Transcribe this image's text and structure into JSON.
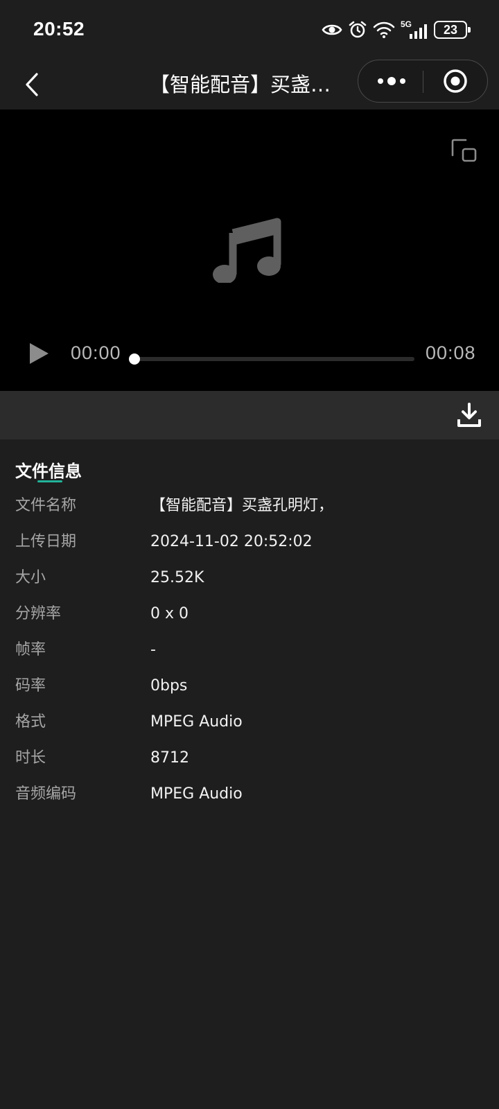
{
  "status_bar": {
    "time": "20:52",
    "network_label": "5G",
    "battery_level": "23"
  },
  "nav": {
    "title": "【智能配音】买盏…"
  },
  "player": {
    "current_time": "00:00",
    "total_time": "00:08",
    "progress_fraction": 0.0
  },
  "file_info": {
    "section_title": "文件信息",
    "rows": [
      {
        "label": "文件名称",
        "value": "【智能配音】买盏孔明灯，"
      },
      {
        "label": "上传日期",
        "value": "2024-11-02 20:52:02"
      },
      {
        "label": "大小",
        "value": "25.52K"
      },
      {
        "label": "分辨率",
        "value": "0 x 0"
      },
      {
        "label": "帧率",
        "value": "-"
      },
      {
        "label": "码率",
        "value": "0bps"
      },
      {
        "label": "格式",
        "value": "MPEG Audio"
      },
      {
        "label": "时长",
        "value": "8712"
      },
      {
        "label": "音频编码",
        "value": "MPEG Audio"
      }
    ]
  },
  "colors": {
    "background": "#1e1e1e",
    "player_background": "#000000",
    "toolbar_background": "#2c2c2c",
    "accent": "#22b39a",
    "label_text": "#a6a6a6",
    "value_text": "#f2f2f2"
  },
  "icons": {
    "back": "chevron-left-icon",
    "more": "more-dots-icon",
    "close": "target-circle-icon",
    "pip": "picture-in-picture-icon",
    "music": "music-note-icon",
    "play": "play-icon",
    "download": "download-icon"
  }
}
